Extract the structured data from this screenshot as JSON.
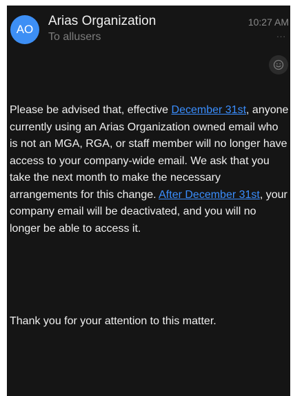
{
  "header": {
    "avatar_initials": "AO",
    "sender": "Arias Organization",
    "recipients": "To allusers",
    "time": "10:27 AM",
    "more_glyph": "...",
    "reaction_icon": "smiley-face-icon"
  },
  "message": {
    "p1_before_link": "Please be advised that, effective ",
    "p1_link": "December 31st",
    "p1_after_link": ", anyone currently using an Arias Organization owned email who is not an MGA, RGA, or staff member will no longer have access to your company-wide email. We ask that you take the next month to make the necessary arrangements for this change. ",
    "p1_link2": "After December 31st",
    "p1_end": ", your company email will be deactivated, and you will no longer be able to access it.",
    "closing": "Thank you for your attention to this matter."
  },
  "colors": {
    "background": "#151515",
    "avatar": "#3d8ff5",
    "link": "#3a8eff",
    "text": "#f0f0f0",
    "muted": "#7d7d7d"
  }
}
